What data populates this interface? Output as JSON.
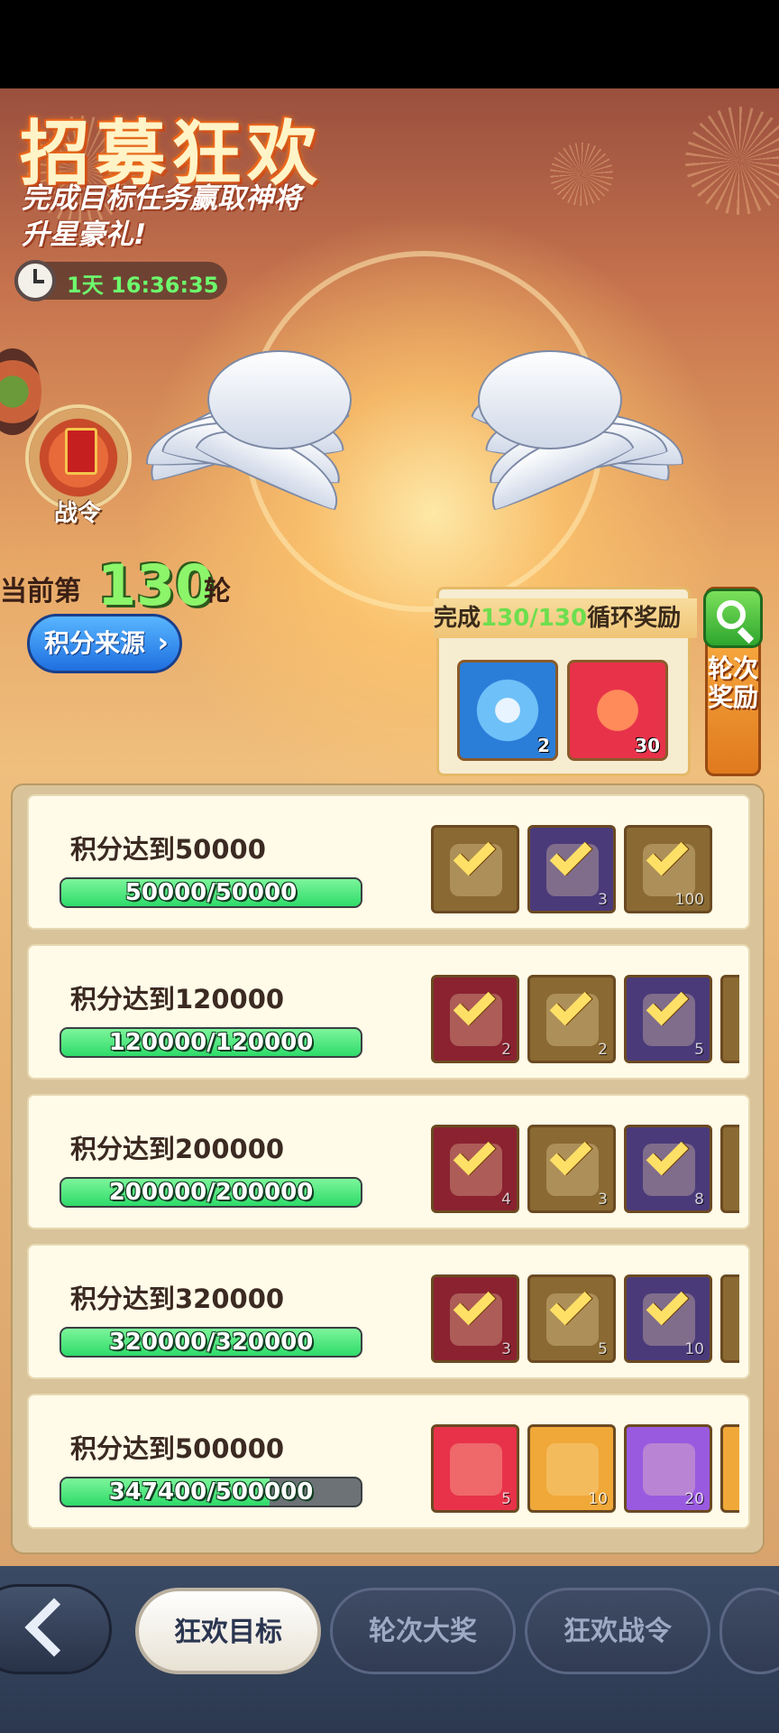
{
  "event": {
    "title": "招募狂欢",
    "subtitle": "完成目标任务赢取神将升星豪礼!",
    "timer": "1天 16:36:35",
    "pass_label": "战令",
    "round_prefix": "当前第",
    "round_number": "130",
    "round_suffix": "轮",
    "source_button": "积分来源",
    "cycle_reward": {
      "prefix": "完成",
      "progress": "130/130",
      "suffix": "循环奖励",
      "items": [
        {
          "icon": "gem-frame-icon",
          "count": "2",
          "color": "#3aa8f0"
        },
        {
          "icon": "red-puzzle-icon",
          "count": "30",
          "color": "#e8324a"
        }
      ]
    },
    "round_reward_button": "轮次奖励"
  },
  "tasks": [
    {
      "title": "积分达到50000",
      "progress_text": "50000/50000",
      "progress": 1.0,
      "rewards": [
        {
          "icon": "blue-scroll-icon",
          "count": "",
          "bg": "#8a6a32",
          "claimed": true
        },
        {
          "icon": "gold-scroll-icon",
          "count": "3",
          "bg": "#4a3a7a",
          "claimed": true
        },
        {
          "icon": "green-dragon-pouch-icon",
          "count": "100",
          "bg": "#8a6a32",
          "claimed": true
        }
      ]
    },
    {
      "title": "积分达到120000",
      "progress_text": "120000/120000",
      "progress": 1.0,
      "rewards": [
        {
          "icon": "red-puzzle-icon",
          "count": "2",
          "bg": "#8a2230",
          "claimed": true
        },
        {
          "icon": "blue-scroll-icon",
          "count": "2",
          "bg": "#8a6a32",
          "claimed": true
        },
        {
          "icon": "gold-scroll-icon",
          "count": "5",
          "bg": "#4a3a7a",
          "claimed": true
        },
        {
          "icon": "extra-reward-icon",
          "count": "",
          "bg": "#8a6a32",
          "claimed": true
        }
      ]
    },
    {
      "title": "积分达到200000",
      "progress_text": "200000/200000",
      "progress": 1.0,
      "rewards": [
        {
          "icon": "red-puzzle-icon",
          "count": "4",
          "bg": "#8a2230",
          "claimed": true
        },
        {
          "icon": "blue-scroll-icon",
          "count": "3",
          "bg": "#8a6a32",
          "claimed": true
        },
        {
          "icon": "gold-scroll-icon",
          "count": "8",
          "bg": "#4a3a7a",
          "claimed": true
        },
        {
          "icon": "extra-reward-icon",
          "count": "",
          "bg": "#8a6a32",
          "claimed": true
        }
      ]
    },
    {
      "title": "积分达到320000",
      "progress_text": "320000/320000",
      "progress": 1.0,
      "rewards": [
        {
          "icon": "red-puzzle-icon",
          "count": "3",
          "bg": "#8a2230",
          "claimed": true
        },
        {
          "icon": "blue-scroll-icon",
          "count": "5",
          "bg": "#8a6a32",
          "claimed": true
        },
        {
          "icon": "gold-scroll-icon",
          "count": "10",
          "bg": "#4a3a7a",
          "claimed": true
        },
        {
          "icon": "extra-reward-icon",
          "count": "",
          "bg": "#8a6a32",
          "claimed": true
        }
      ]
    },
    {
      "title": "积分达到500000",
      "progress_text": "347400/500000",
      "progress": 0.6948,
      "rewards": [
        {
          "icon": "red-puzzle-icon",
          "count": "5",
          "bg": "#e8324a",
          "claimed": false
        },
        {
          "icon": "blue-orb-scroll-icon",
          "count": "10",
          "bg": "#f0a838",
          "claimed": false
        },
        {
          "icon": "moon-scroll-icon",
          "count": "20",
          "bg": "#9a5ae0",
          "claimed": false
        },
        {
          "icon": "extra-reward-icon",
          "count": "",
          "bg": "#f0a838",
          "claimed": false
        }
      ]
    }
  ],
  "tabs": [
    {
      "label": "狂欢目标",
      "active": true
    },
    {
      "label": "轮次大奖",
      "active": false
    },
    {
      "label": "狂欢战令",
      "active": false
    }
  ],
  "colors": {
    "accent_green": "#6dfc6d",
    "progress_fill": "#2edb6a"
  }
}
